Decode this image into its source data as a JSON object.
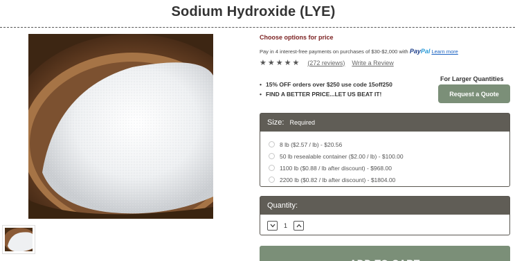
{
  "product": {
    "title": "Sodium Hydroxide (LYE)"
  },
  "pricing": {
    "choose_label": "Choose options for price",
    "paypal_text": "Pay in 4 interest-free payments on purchases of $30-$2,000 with",
    "paypal_brand_1": "Pay",
    "paypal_brand_2": "Pal",
    "learn_more": "Learn more"
  },
  "rating": {
    "stars": "★★★★★",
    "reviews": "(272 reviews)",
    "write_review": "Write a Review"
  },
  "promos": [
    "15% OFF orders over $250 use code 15off250",
    "FIND A BETTER PRICE...LET US BEAT IT!"
  ],
  "quote": {
    "heading": "For Larger Quantities",
    "button": "Request a Quote"
  },
  "size": {
    "label": "Size:",
    "required": "Required",
    "options": [
      "8 lb ($2.57 / lb) - $20.56",
      "50 lb resealable container ($2.00 / lb) - $100.00",
      "1100 lb ($0.88 / lb after discount) - $968.00",
      "2200 lb ($0.82 / lb after discount) - $1804.00"
    ]
  },
  "quantity": {
    "label": "Quantity:",
    "value": "1"
  },
  "cart": {
    "button": "ADD TO CART"
  },
  "colors": {
    "accent_green": "#7b8f78",
    "panel_header": "#605d56",
    "choose_red": "#7a1f1f",
    "paypal_dark": "#1e3f8a",
    "paypal_light": "#2a9bd8"
  },
  "icons": {
    "decrease": "chevron-down-icon",
    "increase": "chevron-up-icon",
    "star": "star-icon",
    "radio": "radio-icon"
  }
}
